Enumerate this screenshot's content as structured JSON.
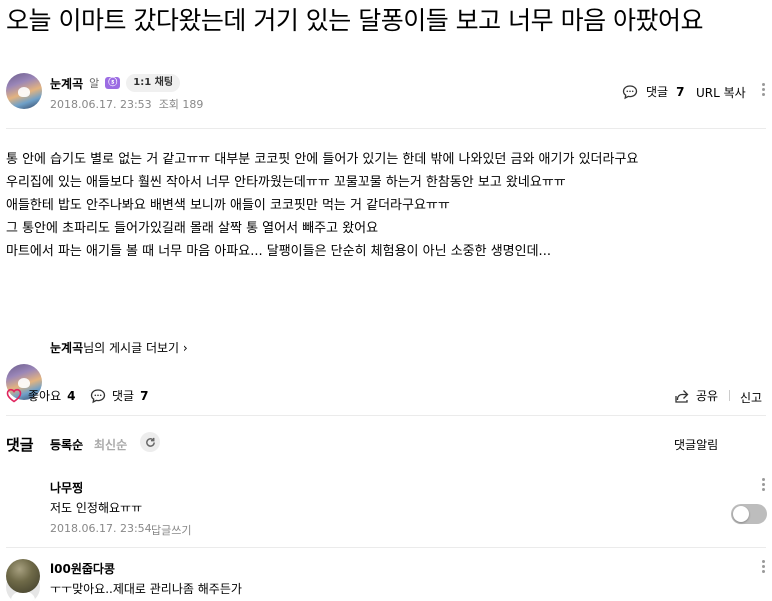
{
  "post": {
    "title": "오늘 이마트 갔다왔는데 거기 있는 달퐁이들 보고 너무 마음 아팠어요",
    "author": "눈계곡",
    "author_level": "알",
    "chat_badge": "1:1 채팅",
    "date": "2018.06.17. 23:53",
    "views": "조회 189",
    "comment_label": "댓글",
    "comment_count": "7",
    "url_copy": "URL 복사",
    "body_lines": [
      "통 안에 습기도 별로 없는 거 같고ㅠㅠ 대부분 코코핏 안에 들어가 있기는 한데 밖에 나와있던 금와 애기가 있더라구요",
      "우리집에 있는 애들보다 훨씬 작아서 너무 안타까웠는데ㅠㅠ 꼬물꼬물 하는거 한참동안 보고 왔네요ㅠㅠ",
      "애들한테 밥도 안주나봐요 배변색 보니까 애들이 코코핏만 먹는 거 같더라구요ㅠㅠ",
      "그 통안에 초파리도 들어가있길래 몰래 살짝 통 열어서 빼주고 왔어요",
      "마트에서 파는 애기들 볼 때 너무 마음 아파요... 달팽이들은 단순히 체험용이 아닌 소중한 생명인데..."
    ],
    "more_posts": "님의 게시글 더보기",
    "like_label": "좋아요",
    "like_count": "4",
    "share_label": "공유",
    "report_label": "신고"
  },
  "comments_section": {
    "title": "댓글",
    "sort_registered": "등록순",
    "sort_latest": "최신순",
    "notify_label": "댓글알림",
    "notify_on": false
  },
  "comments": [
    {
      "author": "나무찡",
      "text": "저도 인정해요ㅠㅠ",
      "date": "2018.06.17. 23:54",
      "reply": "답글쓰기"
    },
    {
      "author": "l00원줍다콩",
      "text": "ㅜㅜ맞아요..제대로 관리나좀 해주든가"
    }
  ],
  "colors": {
    "heart": "#e0245e",
    "badge": "#9c6ce3",
    "toggle_off": "#bdbdbd"
  }
}
